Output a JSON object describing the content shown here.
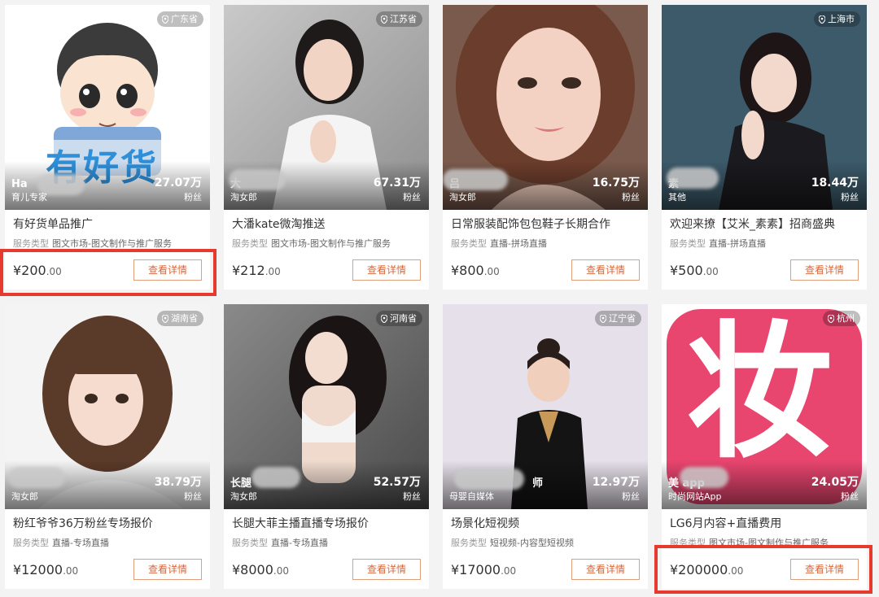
{
  "cards": [
    {
      "location": "广东省",
      "author_name": "Ha",
      "author_type": "育儿专家",
      "fans_count": "27.07万",
      "fans_label": "粉丝",
      "logo_text": "有好货",
      "title": "有好货单品推广",
      "service_label": "服务类型",
      "service_value": "图文市场-图文制作与推广服务",
      "price_int": "¥200",
      "price_dec": ".00",
      "button_label": "查看详情"
    },
    {
      "location": "江苏省",
      "author_name": "大",
      "author_type": "淘女郎",
      "fans_count": "67.31万",
      "fans_label": "粉丝",
      "title": "大潘kate微淘推送",
      "service_label": "服务类型",
      "service_value": "图文市场-图文制作与推广服务",
      "price_int": "¥212",
      "price_dec": ".00",
      "button_label": "查看详情"
    },
    {
      "location": "",
      "author_name": "吕",
      "author_type": "淘女郎",
      "fans_count": "16.75万",
      "fans_label": "粉丝",
      "title": "日常服装配饰包包鞋子长期合作",
      "service_label": "服务类型",
      "service_value": "直播-拼场直播",
      "price_int": "¥800",
      "price_dec": ".00",
      "button_label": "查看详情"
    },
    {
      "location": "上海市",
      "author_name": "素",
      "author_type": "其他",
      "fans_count": "18.44万",
      "fans_label": "粉丝",
      "title": "欢迎来撩【艾米_素素】招商盛典",
      "service_label": "服务类型",
      "service_value": "直播-拼场直播",
      "price_int": "¥500",
      "price_dec": ".00",
      "button_label": "查看详情"
    },
    {
      "location": "湖南省",
      "author_name": "",
      "author_type": "淘女郎",
      "fans_count": "38.79万",
      "fans_label": "粉丝",
      "title": "粉红爷爷36万粉丝专场报价",
      "service_label": "服务类型",
      "service_value": "直播-专场直播",
      "price_int": "¥12000",
      "price_dec": ".00",
      "button_label": "查看详情"
    },
    {
      "location": "河南省",
      "author_name": "长腿",
      "author_type": "淘女郎",
      "fans_count": "52.57万",
      "fans_label": "粉丝",
      "title": "长腿大菲主播直播专场报价",
      "service_label": "服务类型",
      "service_value": "直播-专场直播",
      "price_int": "¥8000",
      "price_dec": ".00",
      "button_label": "查看详情"
    },
    {
      "location": "辽宁省",
      "author_name": "师",
      "author_type": "母婴自媒体",
      "fans_count": "12.97万",
      "fans_label": "粉丝",
      "title": "场景化短视频",
      "service_label": "服务类型",
      "service_value": "短视频-内容型短视频",
      "price_int": "¥17000",
      "price_dec": ".00",
      "button_label": "查看详情"
    },
    {
      "location": "杭州",
      "author_name": "美 app",
      "author_type": "时尚网站App",
      "fans_count": "24.05万",
      "fans_label": "粉丝",
      "logo_text": "妆",
      "title": "LG6月内容+直播费用",
      "service_label": "服务类型",
      "service_value": "图文市场-图文制作与推广服务",
      "price_int": "¥200000",
      "price_dec": ".00",
      "button_label": "查看详情"
    }
  ],
  "colors": {
    "accent": "#d9673a",
    "button_border": "#e0a07c",
    "highlight": "#e63a2f",
    "logo_pink": "#e8456f"
  }
}
